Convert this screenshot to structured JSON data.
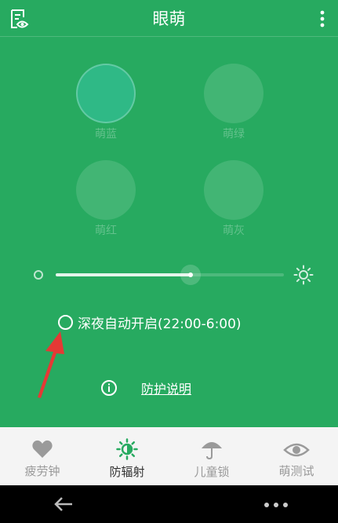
{
  "app_title": "眼萌",
  "modes": [
    {
      "label": "萌蓝",
      "selected": true
    },
    {
      "label": "萌绿",
      "selected": false
    },
    {
      "label": "萌红",
      "selected": false
    },
    {
      "label": "萌灰",
      "selected": false
    }
  ],
  "brightness_slider": {
    "value": 0.59
  },
  "night_mode": {
    "label": "深夜自动开启(22:00-6:00)",
    "checked": false
  },
  "info_link": {
    "label": "防护说明"
  },
  "tabs": [
    {
      "label": "疲劳钟",
      "icon": "heart-icon",
      "active": false
    },
    {
      "label": "防辐射",
      "icon": "sun-icon",
      "active": true
    },
    {
      "label": "儿童锁",
      "icon": "umbrella-icon",
      "active": false
    },
    {
      "label": "萌测试",
      "icon": "eye-icon",
      "active": false
    }
  ],
  "colors": {
    "brand_green": "#27aa60",
    "selected_mode": "#2fb986",
    "tab_active": "#27aa60",
    "tab_inactive": "#999999",
    "annotation_arrow": "#e53935"
  }
}
